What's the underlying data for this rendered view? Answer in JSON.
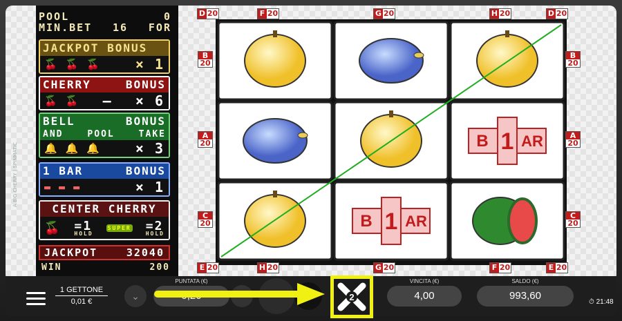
{
  "pool": {
    "label": "POOL",
    "value": "0",
    "minbet_label": "MIN.BET",
    "minbet_value": "16",
    "for_label": "FOR"
  },
  "paytable": {
    "jackpot_bonus": {
      "title": "JACKPOT BONUS",
      "mult": "1"
    },
    "cherry_bonus": {
      "title": "CHERRY",
      "title2": "BONUS",
      "dash": "–",
      "mult": "6"
    },
    "bell_bonus": {
      "title": "BELL",
      "title2": "BONUS",
      "sub1": "AND",
      "sub2": "POOL",
      "sub3": "TAKE",
      "mult": "3"
    },
    "bar_bonus": {
      "title": "1 BAR",
      "title2": "BONUS",
      "mult": "1"
    },
    "center_cherry": {
      "title": "CENTER CHERRY",
      "v1": "1",
      "v2": "2",
      "hold": "HOLD",
      "super": "SUPER"
    },
    "times": "×",
    "equals": "="
  },
  "jackpot": {
    "label": "JACKPOT",
    "value": "32040"
  },
  "win": {
    "label": "WIN",
    "value": "200"
  },
  "brand": "A BIG CHERRY | SPINMATIC",
  "reel_labels": {
    "top": [
      {
        "l": "D",
        "n": "20"
      },
      {
        "l": "F",
        "n": "20"
      },
      {
        "l": "G",
        "n": "20"
      },
      {
        "l": "H",
        "n": "20"
      },
      {
        "l": "D",
        "n": "20"
      }
    ],
    "bottom": [
      {
        "l": "E",
        "n": "20"
      },
      {
        "l": "H",
        "n": "20"
      },
      {
        "l": "G",
        "n": "20"
      },
      {
        "l": "F",
        "n": "20"
      },
      {
        "l": "E",
        "n": "20"
      }
    ],
    "left": [
      {
        "l": "B",
        "n": "20"
      },
      {
        "l": "A",
        "n": "20"
      },
      {
        "l": "C",
        "n": "20"
      }
    ],
    "right": [
      {
        "l": "B",
        "n": "20"
      },
      {
        "l": "A",
        "n": "20"
      },
      {
        "l": "C",
        "n": "20"
      }
    ]
  },
  "symbols": [
    [
      "lemon-icon",
      "plum-icon",
      "lemon-icon"
    ],
    [
      "plum-icon",
      "lemon-icon",
      "bar-1-icon"
    ],
    [
      "lemon-icon",
      "bar-1-icon",
      "watermelon-icon"
    ]
  ],
  "bar_text": {
    "b": "B",
    "one": "1",
    "ar": "AR"
  },
  "bottom": {
    "gettone": "1 GETTONE",
    "gettone_value": "0,01 €",
    "puntata_label": "PUNTATA (€)",
    "puntata_value": "0,20",
    "vincita_label": "VINCITA (€)",
    "vincita_value": "4,00",
    "saldo_label": "SALDO (€)",
    "saldo_value": "993,60",
    "clock": "21:48",
    "x2": "2"
  },
  "colors": {
    "highlight": "#f1f013",
    "payline": "#1fae1f",
    "accent_red": "#c21b1b"
  }
}
